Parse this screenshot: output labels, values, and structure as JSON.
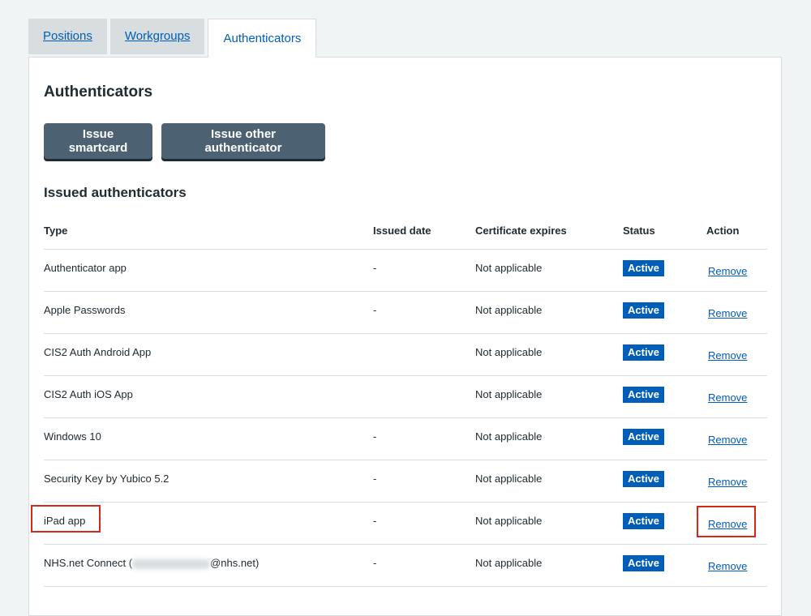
{
  "tabs": [
    {
      "label": "Positions"
    },
    {
      "label": "Workgroups"
    },
    {
      "label": "Authenticators"
    }
  ],
  "panel": {
    "title": "Authenticators",
    "buttons": {
      "issue_smartcard": "Issue smartcard",
      "issue_other": "Issue other authenticator"
    },
    "section_title": "Issued authenticators"
  },
  "table": {
    "headers": {
      "type": "Type",
      "issued_date": "Issued date",
      "cert_expires": "Certificate expires",
      "status": "Status",
      "action": "Action"
    },
    "rows": [
      {
        "type": "Authenticator app",
        "issued_date": "-",
        "cert_expires": "Not applicable",
        "status": "Active",
        "action": "Remove"
      },
      {
        "type": "Apple Passwords",
        "issued_date": "-",
        "cert_expires": "Not applicable",
        "status": "Active",
        "action": "Remove"
      },
      {
        "type": "CIS2 Auth Android App",
        "issued_date": "",
        "cert_expires": "Not applicable",
        "status": "Active",
        "action": "Remove"
      },
      {
        "type": "CIS2 Auth iOS App",
        "issued_date": "",
        "cert_expires": "Not applicable",
        "status": "Active",
        "action": "Remove"
      },
      {
        "type": "Windows 10",
        "issued_date": "-",
        "cert_expires": "Not applicable",
        "status": "Active",
        "action": "Remove"
      },
      {
        "type": "Security Key by Yubico 5.2",
        "issued_date": "-",
        "cert_expires": "Not applicable",
        "status": "Active",
        "action": "Remove"
      },
      {
        "type": "iPad app",
        "issued_date": "-",
        "cert_expires": "Not applicable",
        "status": "Active",
        "action": "Remove"
      },
      {
        "type_prefix": "NHS.net Connect (",
        "type_suffix": "@nhs.net)",
        "issued_date": "-",
        "cert_expires": "Not applicable",
        "status": "Active",
        "action": "Remove"
      }
    ]
  },
  "colors": {
    "link": "#005eb8",
    "badge_bg": "#005eb8",
    "button_bg": "#4c6272",
    "highlight": "#d5281b",
    "page_bg": "#f0f4f5"
  }
}
